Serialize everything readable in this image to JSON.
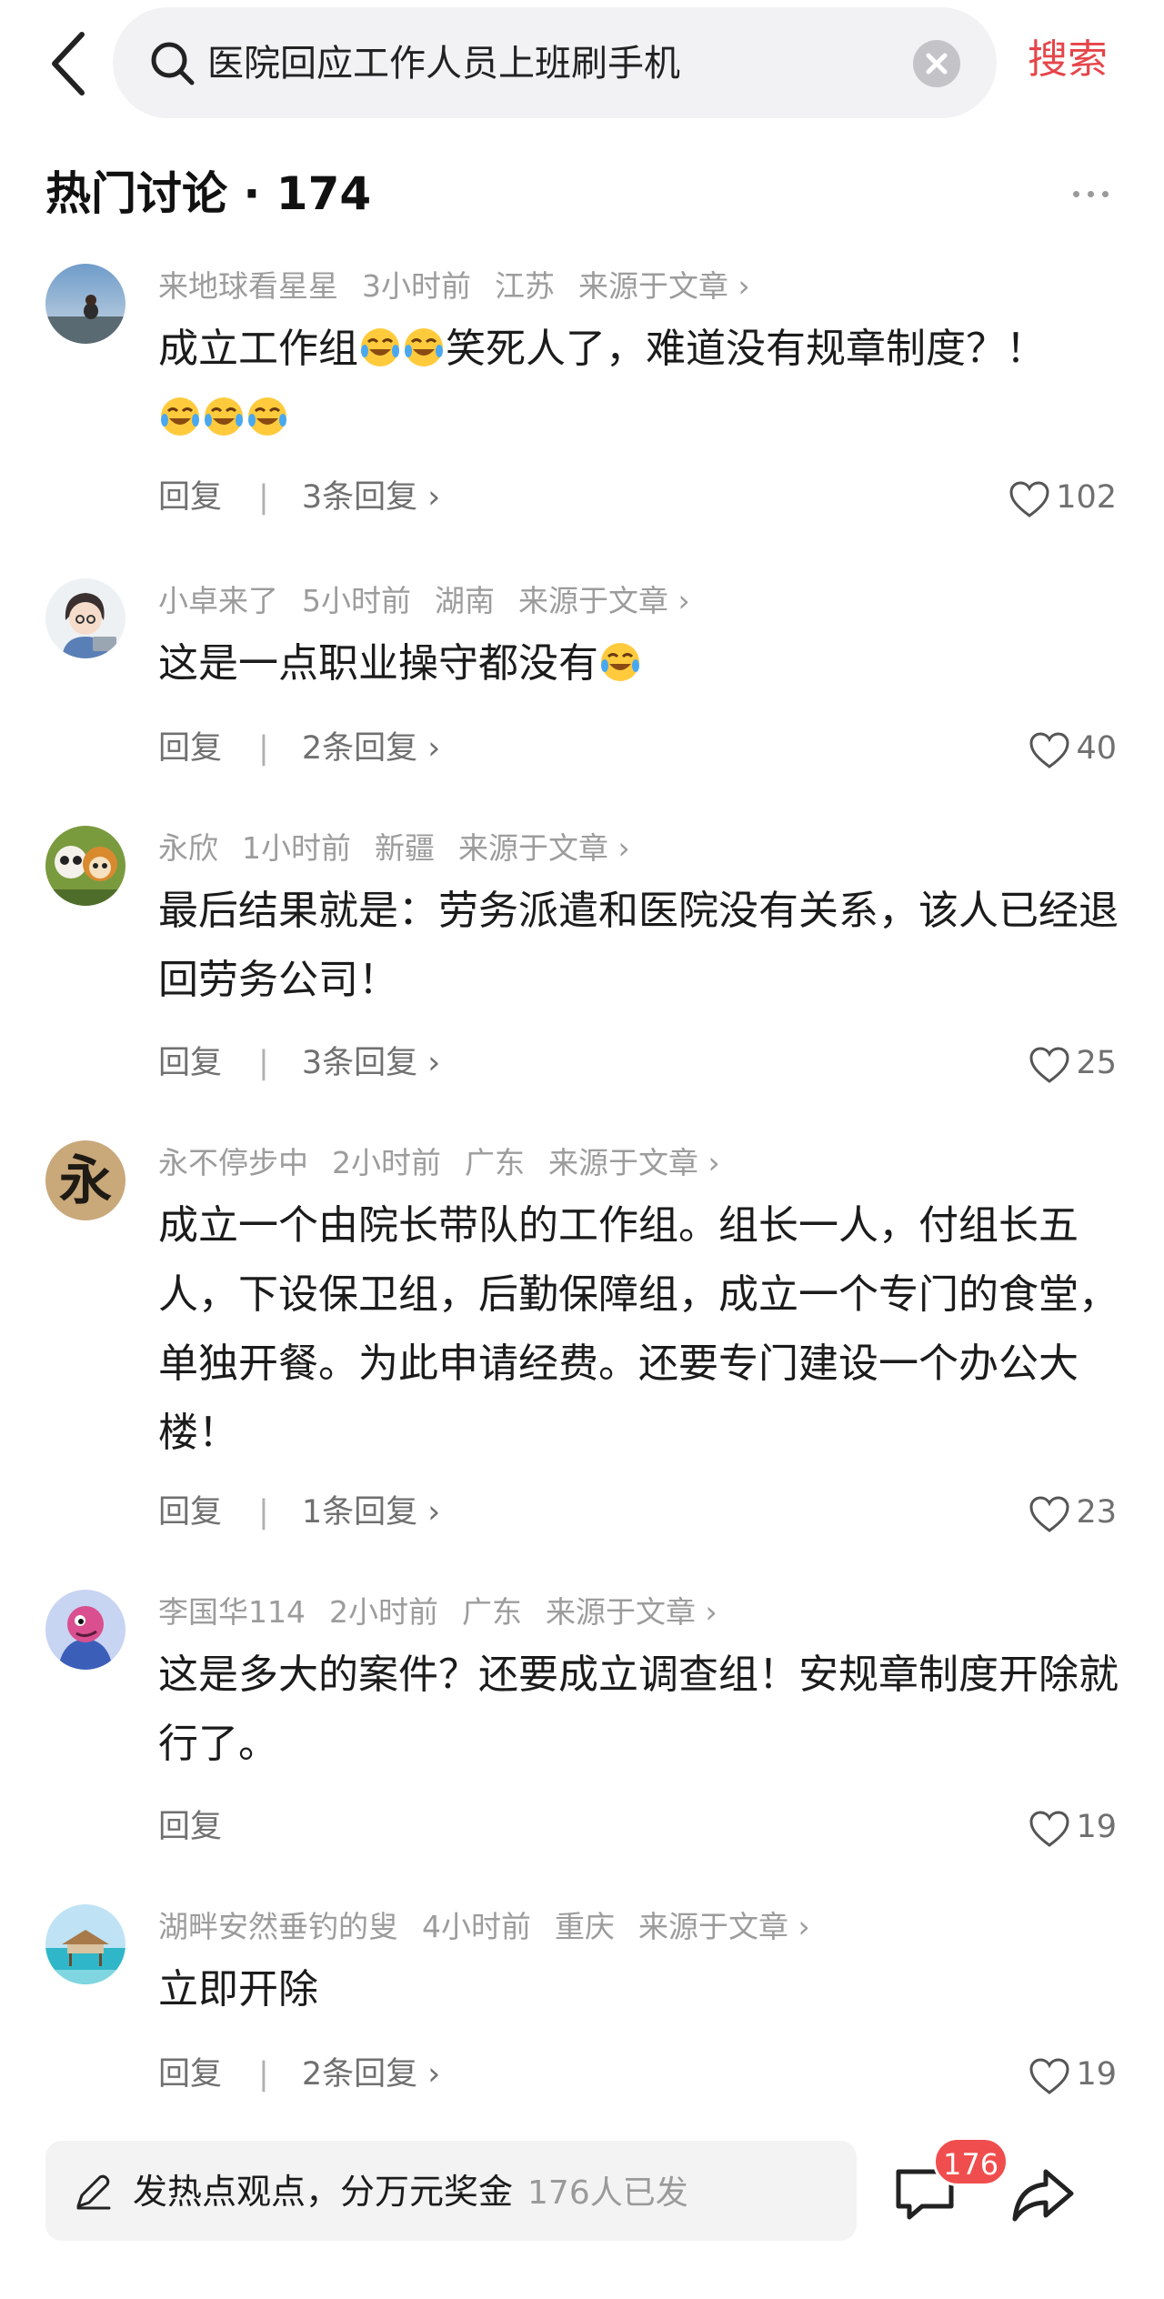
{
  "search": {
    "query": "医院回应工作人员上班刷手机",
    "button": "搜索"
  },
  "section": {
    "title": "热门讨论 · 174"
  },
  "comments": [
    {
      "user": "来地球看星星",
      "time": "3小时前",
      "region": "江苏",
      "source": "来源于文章 ›",
      "text": "成立工作组",
      "text2": "笑死人了，难道没有规章制度？！",
      "reply": "回复",
      "sep": "|",
      "replies": "3条回复 ›",
      "likes": "102"
    },
    {
      "user": "小卓来了",
      "time": "5小时前",
      "region": "湖南",
      "source": "来源于文章 ›",
      "text": "这是一点职业操守都没有",
      "reply": "回复",
      "sep": "|",
      "replies": "2条回复 ›",
      "likes": "40"
    },
    {
      "user": "永欣",
      "time": "1小时前",
      "region": "新疆",
      "source": "来源于文章 ›",
      "text": "最后结果就是：劳务派遣和医院没有关系，该人已经退回劳务公司！",
      "reply": "回复",
      "sep": "|",
      "replies": "3条回复 ›",
      "likes": "25"
    },
    {
      "user": "永不停步中",
      "time": "2小时前",
      "region": "广东",
      "source": "来源于文章 ›",
      "avatar_char": "永",
      "text": "成立一个由院长带队的工作组。组长一人，付组长五人，下设保卫组，后勤保障组，成立一个专门的食堂，单独开餐。为此申请经费。还要专门建设一个办公大楼！",
      "reply": "回复",
      "sep": "|",
      "replies": "1条回复 ›",
      "likes": "23"
    },
    {
      "user": "李国华114",
      "time": "2小时前",
      "region": "广东",
      "source": "来源于文章 ›",
      "text": "这是多大的案件？还要成立调查组！安规章制度开除就行了。",
      "reply": "回复",
      "likes": "19"
    },
    {
      "user": "湖畔安然垂钓的叟",
      "time": "4小时前",
      "region": "重庆",
      "source": "来源于文章 ›",
      "text": "立即开除",
      "reply": "回复",
      "sep": "|",
      "replies": "2条回复 ›",
      "likes": "19"
    }
  ],
  "bottom": {
    "compose": "发热点观点，分万元奖金",
    "compose_count": "176人已发",
    "badge": "176"
  }
}
